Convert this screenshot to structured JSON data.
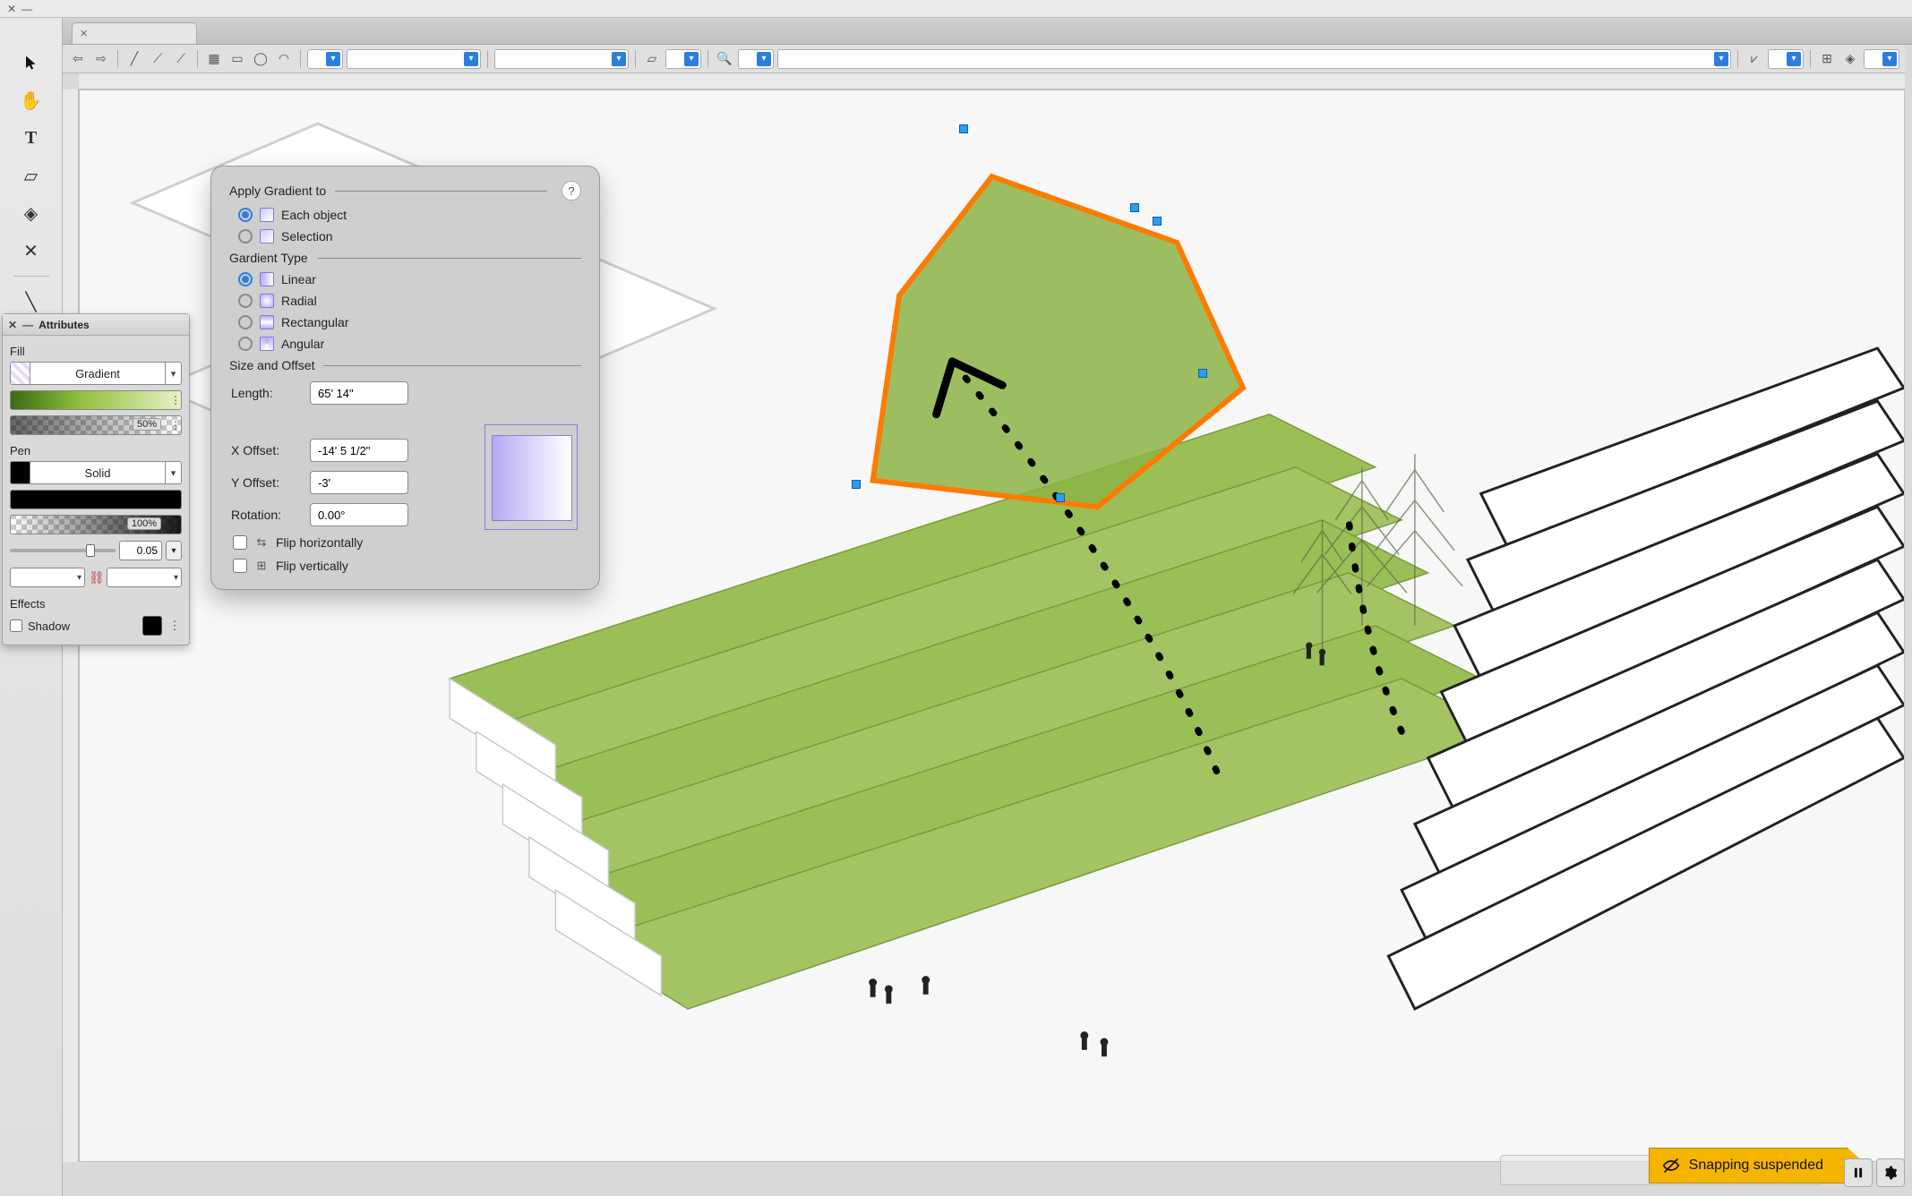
{
  "attributes": {
    "title": "Attributes",
    "fill_label": "Fill",
    "fill_mode": "Gradient",
    "fill_opacity": "50%",
    "pen_label": "Pen",
    "pen_mode": "Solid",
    "pen_opacity": "100%",
    "pen_weight": "0.05",
    "effects_label": "Effects",
    "shadow_label": "Shadow"
  },
  "gradient_popover": {
    "apply_heading": "Apply Gradient to",
    "apply_each": "Each object",
    "apply_selection": "Selection",
    "type_heading": "Gardient Type",
    "type_linear": "Linear",
    "type_radial": "Radial",
    "type_rect": "Rectangular",
    "type_angular": "Angular",
    "size_heading": "Size and Offset",
    "length_label": "Length:",
    "length_value": "65' 14\"",
    "xoff_label": "X Offset:",
    "xoff_value": "-14' 5 1/2\"",
    "yoff_label": "Y Offset:",
    "yoff_value": "-3'",
    "rot_label": "Rotation:",
    "rot_value": "0.00°",
    "flip_h": "Flip horizontally",
    "flip_v": "Flip vertically",
    "help": "?"
  },
  "snap": {
    "message": "Snapping suspended"
  }
}
